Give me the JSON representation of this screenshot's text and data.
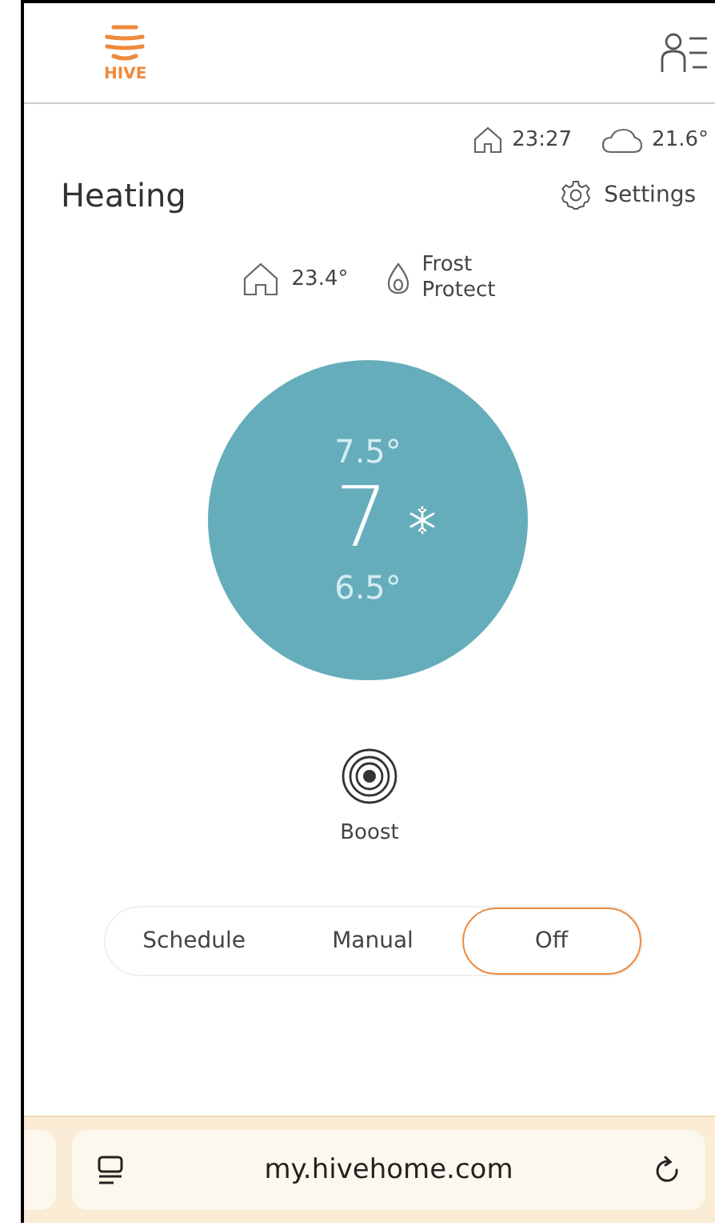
{
  "header": {
    "logo_text": "HIVE"
  },
  "info_bar": {
    "time": "23:27",
    "outdoor_temp": "21.6°"
  },
  "heading": {
    "title": "Heating",
    "settings": "Settings"
  },
  "status": {
    "indoor_temp": "23.4°",
    "mode_line1": "Frost",
    "mode_line2": "Protect"
  },
  "dial": {
    "above": "7.5°",
    "target": "7",
    "below": "6.5°"
  },
  "boost": {
    "label": "Boost"
  },
  "modes": [
    {
      "label": "Schedule",
      "selected": false
    },
    {
      "label": "Manual",
      "selected": false
    },
    {
      "label": "Off",
      "selected": true
    }
  ],
  "browser": {
    "url": "my.hivehome.com"
  }
}
